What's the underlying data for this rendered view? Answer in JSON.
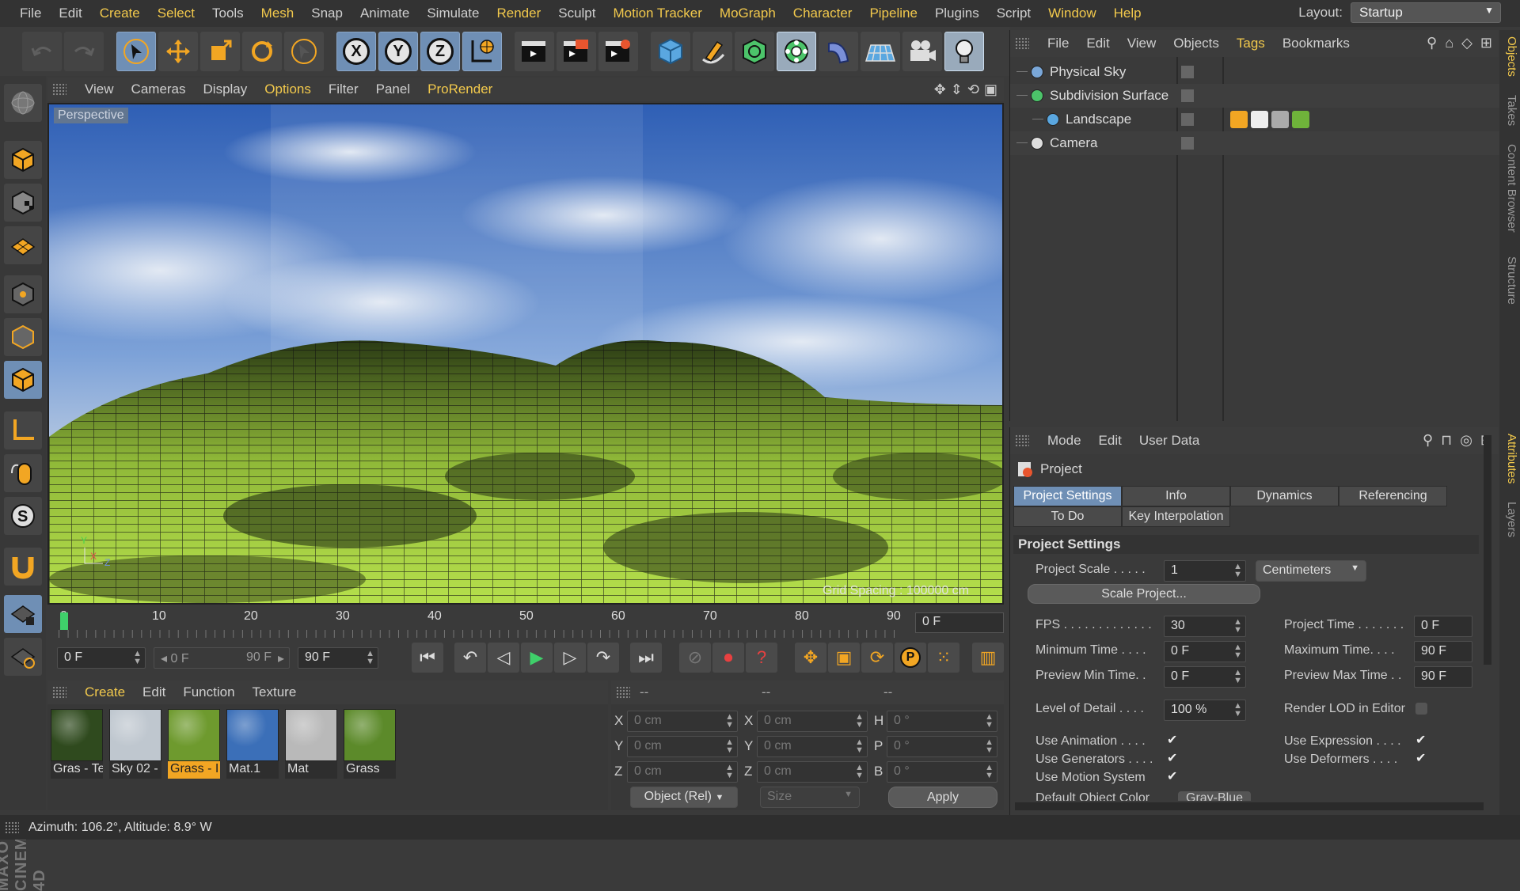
{
  "menubar": {
    "items": [
      {
        "label": "File",
        "hl": false
      },
      {
        "label": "Edit",
        "hl": false
      },
      {
        "label": "Create",
        "hl": true
      },
      {
        "label": "Select",
        "hl": true
      },
      {
        "label": "Tools",
        "hl": false
      },
      {
        "label": "Mesh",
        "hl": true
      },
      {
        "label": "Snap",
        "hl": false
      },
      {
        "label": "Animate",
        "hl": false
      },
      {
        "label": "Simulate",
        "hl": false
      },
      {
        "label": "Render",
        "hl": true
      },
      {
        "label": "Sculpt",
        "hl": false
      },
      {
        "label": "Motion Tracker",
        "hl": true
      },
      {
        "label": "MoGraph",
        "hl": true
      },
      {
        "label": "Character",
        "hl": true
      },
      {
        "label": "Pipeline",
        "hl": true
      },
      {
        "label": "Plugins",
        "hl": false
      },
      {
        "label": "Script",
        "hl": false
      },
      {
        "label": "Window",
        "hl": true
      },
      {
        "label": "Help",
        "hl": true
      }
    ],
    "layout_label": "Layout:",
    "layout_value": "Startup"
  },
  "toolbar": {
    "axis_x": "X",
    "axis_y": "Y",
    "axis_z": "Z"
  },
  "viewport": {
    "menu": [
      {
        "label": "View",
        "hl": false
      },
      {
        "label": "Cameras",
        "hl": false
      },
      {
        "label": "Display",
        "hl": false
      },
      {
        "label": "Options",
        "hl": true
      },
      {
        "label": "Filter",
        "hl": false
      },
      {
        "label": "Panel",
        "hl": false
      },
      {
        "label": "ProRender",
        "hl": true
      }
    ],
    "camera_label": "Perspective",
    "grid_spacing": "Grid Spacing : 100000 cm",
    "colors": {
      "sky_top": "#3f6fc4",
      "sky_mid": "#8fb1df",
      "terrain": "#b8e043",
      "terrain_dark": "#1c2210"
    }
  },
  "timeline": {
    "labels": [
      "0",
      "10",
      "20",
      "30",
      "40",
      "50",
      "60",
      "70",
      "80",
      "90"
    ],
    "current_frame": "0 F",
    "start_field": "0 F",
    "range_start": "0 F",
    "range_end": "90 F",
    "end_field": "90 F"
  },
  "materials": {
    "menu": [
      {
        "label": "Create",
        "hl": true
      },
      {
        "label": "Edit",
        "hl": false
      },
      {
        "label": "Function",
        "hl": false
      },
      {
        "label": "Texture",
        "hl": false
      }
    ],
    "items": [
      {
        "name": "Gras - Te",
        "color": "#2f4a1e",
        "selected": false
      },
      {
        "name": "Sky 02 -",
        "color": "#bfc7cf",
        "selected": false
      },
      {
        "name": "Grass - I",
        "color": "#6e9a2e",
        "selected": true
      },
      {
        "name": "Mat.1",
        "color": "#3b6fb8",
        "selected": false
      },
      {
        "name": "Mat",
        "color": "#b9b9b9",
        "selected": false
      },
      {
        "name": "Grass",
        "color": "#5c8a2a",
        "selected": false
      }
    ]
  },
  "coordinates": {
    "header": [
      "--",
      "--",
      "--"
    ],
    "rows": [
      {
        "a": "X",
        "av": "0 cm",
        "b": "X",
        "bv": "0 cm",
        "c": "H",
        "cv": "0 °"
      },
      {
        "a": "Y",
        "av": "0 cm",
        "b": "Y",
        "bv": "0 cm",
        "c": "P",
        "cv": "0 °"
      },
      {
        "a": "Z",
        "av": "0 cm",
        "b": "Z",
        "bv": "0 cm",
        "c": "B",
        "cv": "0 °"
      }
    ],
    "mode": "Object (Rel)",
    "size": "Size",
    "apply": "Apply"
  },
  "status": {
    "text": "Azimuth: 106.2°, Altitude: 8.9°  W"
  },
  "objects": {
    "menu": [
      {
        "label": "File",
        "hl": false
      },
      {
        "label": "Edit",
        "hl": false
      },
      {
        "label": "View",
        "hl": false
      },
      {
        "label": "Objects",
        "hl": false
      },
      {
        "label": "Tags",
        "hl": true
      },
      {
        "label": "Bookmarks",
        "hl": false
      }
    ],
    "items": [
      {
        "name": "Physical Sky",
        "indent": 0
      },
      {
        "name": "Subdivision Surface",
        "indent": 0
      },
      {
        "name": "Landscape",
        "indent": 1
      },
      {
        "name": "Camera",
        "indent": 0
      }
    ]
  },
  "attributes": {
    "menu": [
      {
        "label": "Mode",
        "hl": false
      },
      {
        "label": "Edit",
        "hl": false
      },
      {
        "label": "User Data",
        "hl": false
      }
    ],
    "title": "Project",
    "tabs_row1": [
      "Project Settings",
      "Info",
      "Dynamics",
      "Referencing"
    ],
    "tabs_row2": [
      "To Do",
      "Key Interpolation"
    ],
    "section": "Project Settings",
    "project_scale_label": "Project Scale . . . . .",
    "project_scale_value": "1",
    "project_scale_unit": "Centimeters",
    "scale_project_button": "Scale Project...",
    "fps_label": "FPS . . . . . . . . . . . . .",
    "fps_value": "30",
    "project_time_label": "Project Time . . . . . . .",
    "project_time_value": "0 F",
    "min_time_label": "Minimum Time . . . .",
    "min_time_value": "0 F",
    "max_time_label": "Maximum Time. . . .",
    "max_time_value": "90 F",
    "prev_min_label": "Preview Min Time. .",
    "prev_min_value": "0 F",
    "prev_max_label": "Preview Max Time . .",
    "prev_max_value": "90 F",
    "lod_label": "Level of Detail . . . .",
    "lod_value": "100 %",
    "render_lod_label": "Render LOD in Editor",
    "use_animation": "Use Animation . . . .",
    "use_expression": "Use Expression . . . .",
    "use_generators": "Use Generators . . . .",
    "use_deformers": "Use Deformers . . . .",
    "use_motion": "Use Motion System",
    "default_color_label": "Default Object Color",
    "default_color_value": "Gray-Blue"
  },
  "side_tabs": {
    "objects": "Objects",
    "takes": "Takes",
    "content": "Content Browser",
    "structure": "Structure",
    "attributes": "Attributes",
    "layers": "Layers"
  }
}
